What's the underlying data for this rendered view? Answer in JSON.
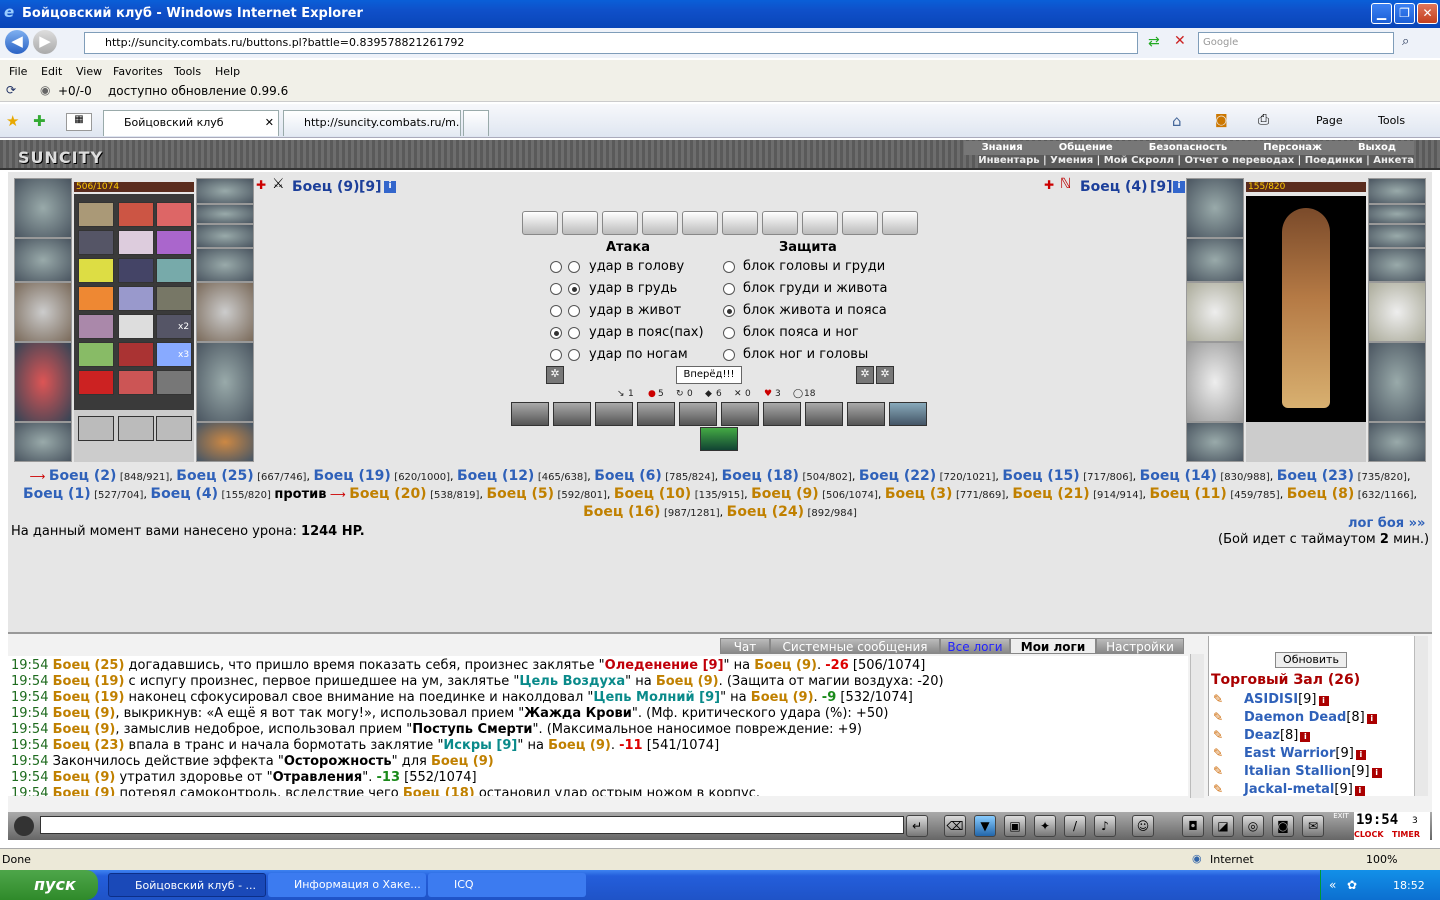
{
  "window": {
    "title": "Бойцовский клуб - Windows Internet Explorer",
    "min": "▁",
    "max": "❐",
    "close": "✕"
  },
  "address": {
    "url": "http://suncity.combats.ru/buttons.pl?battle=0.839578821261792",
    "search_placeholder": "Google"
  },
  "menu": [
    "File",
    "Edit",
    "View",
    "Favorites",
    "Tools",
    "Help"
  ],
  "status_line": {
    "counter": "+0/-0",
    "update": "доступно обновление 0.99.6"
  },
  "tabs": [
    {
      "label": "Бойцовский клуб"
    },
    {
      "label": "http://suncity.combats.ru/m..."
    }
  ],
  "toolbar_right": {
    "page": "Page",
    "tools": "Tools"
  },
  "game_header": {
    "logo": "SUNCITY",
    "row1": [
      "Знания",
      "Общение",
      "Безопасность",
      "Персонаж",
      "Выход"
    ],
    "row2": "Инвентарь | Умения | Мой Скролл | Отчет о переводах | Поединки | Анкета"
  },
  "player": {
    "name": "Боец (9)",
    "level": "[9]",
    "hp": "506/1074",
    "hp_fraction": 0.471
  },
  "enemy": {
    "name": "Боец (4)",
    "level": "[9]",
    "hp": "155/820",
    "hp_fraction": 0.189
  },
  "inventory_badges": {
    "x2": "x2",
    "x3": "x3"
  },
  "combat": {
    "attack_title": "Атака",
    "defense_title": "Защита",
    "attacks": [
      "удар в голову",
      "удар в грудь",
      "удар в живот",
      "удар в пояс(пах)",
      "удар по ногам"
    ],
    "defenses": [
      "блок головы и груди",
      "блок груди и живота",
      "блок живота и пояса",
      "блок пояса и ног",
      "блок ног и головы"
    ],
    "forward": "Вперёд!!!",
    "stats": [
      "1",
      "5",
      "0",
      "6",
      "0",
      "3",
      "18"
    ]
  },
  "teams": {
    "team1": [
      [
        "Боец (2)",
        "[848/921]"
      ],
      [
        "Боец (25)",
        "[667/746]"
      ],
      [
        "Боец (19)",
        "[620/1000]"
      ],
      [
        "Боец (12)",
        "[465/638]"
      ],
      [
        "Боец (6)",
        "[785/824]"
      ],
      [
        "Боец (18)",
        "[504/802]"
      ],
      [
        "Боец (22)",
        "[720/1021]"
      ],
      [
        "Боец (15)",
        "[717/806]"
      ],
      [
        "Боец (14)",
        "[830/988]"
      ],
      [
        "Боец (23)",
        "[735/820]"
      ],
      [
        "Боец (1)",
        "[527/704]"
      ],
      [
        "Боец (4)",
        "[155/820]"
      ]
    ],
    "versus": "против",
    "team2": [
      [
        "Боец (20)",
        "[538/819]"
      ],
      [
        "Боец (5)",
        "[592/801]"
      ],
      [
        "Боец (10)",
        "[135/915]"
      ],
      [
        "Боец (9)",
        "[506/1074]"
      ],
      [
        "Боец (3)",
        "[771/869]"
      ],
      [
        "Боец (21)",
        "[914/914]"
      ],
      [
        "Боец (11)",
        "[459/785]"
      ],
      [
        "Боец (8)",
        "[632/1166]"
      ],
      [
        "Боец (16)",
        "[987/1281]"
      ],
      [
        "Боец (24)",
        "[892/984]"
      ]
    ]
  },
  "damage": {
    "prefix": "На данный момент вами нанесено урона:",
    "value": "1244 HP."
  },
  "battle_log_link": "лог боя »»",
  "timeout": {
    "prefix": "(Бой идет с таймаутом",
    "value": "2",
    "suffix": "мин.)"
  },
  "chat_tabs": [
    "Чат",
    "Системные сообщения",
    "Все логи",
    "Мои логи",
    "Настройки"
  ],
  "log": [
    {
      "t": "19:54",
      "a": "Боец (25)",
      "txt": " догадавшись, что пришло время показать себя, произнес заклятье \"",
      "sp": "Оледенение [9]",
      "sc": "red",
      "txt2": "\" на ",
      "b": "Боец (9)",
      "txt3": ". ",
      "dmg": "-26",
      "rest": " [506/1074]"
    },
    {
      "t": "19:54",
      "a": "Боец (19)",
      "txt": " с испугу произнес, первое пришедшее на ум, заклятье \"",
      "sp": "Цель Воздуха",
      "sc": "teal",
      "txt2": "\" на ",
      "b": "Боец (9)",
      "txt3": ". (Защита от магии воздуха: -20)",
      "dmg": "",
      "rest": ""
    },
    {
      "t": "19:54",
      "a": "Боец (19)",
      "txt": " наконец сфокусировал свое внимание на поединке и наколдовал \"",
      "sp": "Цепь Молний [9]",
      "sc": "teal",
      "txt2": "\" на ",
      "b": "Боец (9)",
      "txt3": ". ",
      "dmg": "-9",
      "rest": " [532/1074]"
    },
    {
      "t": "19:54",
      "a": "Боец (9)",
      "txt": ", выкрикнув: «А ещё я вот так могу!», использовал прием \"",
      "sp": "Жажда Крови",
      "sc": "bold",
      "txt2": "\". (Мф. критического удара (%): +50)",
      "b": "",
      "txt3": "",
      "dmg": "",
      "rest": ""
    },
    {
      "t": "19:54",
      "a": "Боец (9)",
      "txt": ", замыслив недоброе, использовал прием \"",
      "sp": "Поступь Смерти",
      "sc": "bold",
      "txt2": "\". (Максимальное наносимое повреждение: +9)",
      "b": "",
      "txt3": "",
      "dmg": "",
      "rest": ""
    },
    {
      "t": "19:54",
      "a": "Боец (23)",
      "txt": " впала в транс и начала бормотать заклятие \"",
      "sp": "Искры [9]",
      "sc": "teal",
      "txt2": "\" на ",
      "b": "Боец (9)",
      "txt3": ". ",
      "dmg": "-11",
      "rest": " [541/1074]"
    },
    {
      "t": "19:54",
      "a": "",
      "txt": "Закончилось действие эффекта \"",
      "sp": "Осторожность",
      "sc": "bold",
      "txt2": "\" для ",
      "b": "Боец (9)",
      "txt3": "",
      "dmg": "",
      "rest": ""
    },
    {
      "t": "19:54",
      "a": "Боец (9)",
      "txt": " утратил здоровье от \"",
      "sp": "Отравления",
      "sc": "bold",
      "txt2": "\". ",
      "b": "",
      "txt3": "",
      "dmg": "-13",
      "rest": " [552/1074]"
    },
    {
      "t": "19:54",
      "a": "Боец (9)",
      "txt": " потерял самоконтроль, вследствие чего ",
      "sp": "",
      "sc": "",
      "txt2": "",
      "b": "Боец (18)",
      "txt3": " остановил удар острым ножом в корпус.",
      "dmg": "",
      "rest": ""
    }
  ],
  "side": {
    "refresh": "Обновить",
    "room": "Торговый Зал (26)",
    "users": [
      {
        "name": "ASIDISI",
        "lvl": "[9]"
      },
      {
        "name": "Daemon Dead",
        "lvl": "[8]"
      },
      {
        "name": "Deaz",
        "lvl": "[8]"
      },
      {
        "name": "East Warrior",
        "lvl": "[9]"
      },
      {
        "name": "Italian Stallion",
        "lvl": "[9]"
      },
      {
        "name": "Jackal-metal",
        "lvl": "[9]"
      }
    ]
  },
  "clock": {
    "time": "19:54",
    "sec": "3",
    "clock_label": "CLOCK",
    "timer_label": "TIMER",
    "exit": "EXIT"
  },
  "statusbar": {
    "left": "Done",
    "zone": "Internet",
    "zoom": "100%"
  },
  "taskbar": {
    "start": "пуск",
    "items": [
      "Бойцовский клуб - ...",
      "Информация о Хаке...",
      "ICQ"
    ],
    "time": "18:52"
  }
}
